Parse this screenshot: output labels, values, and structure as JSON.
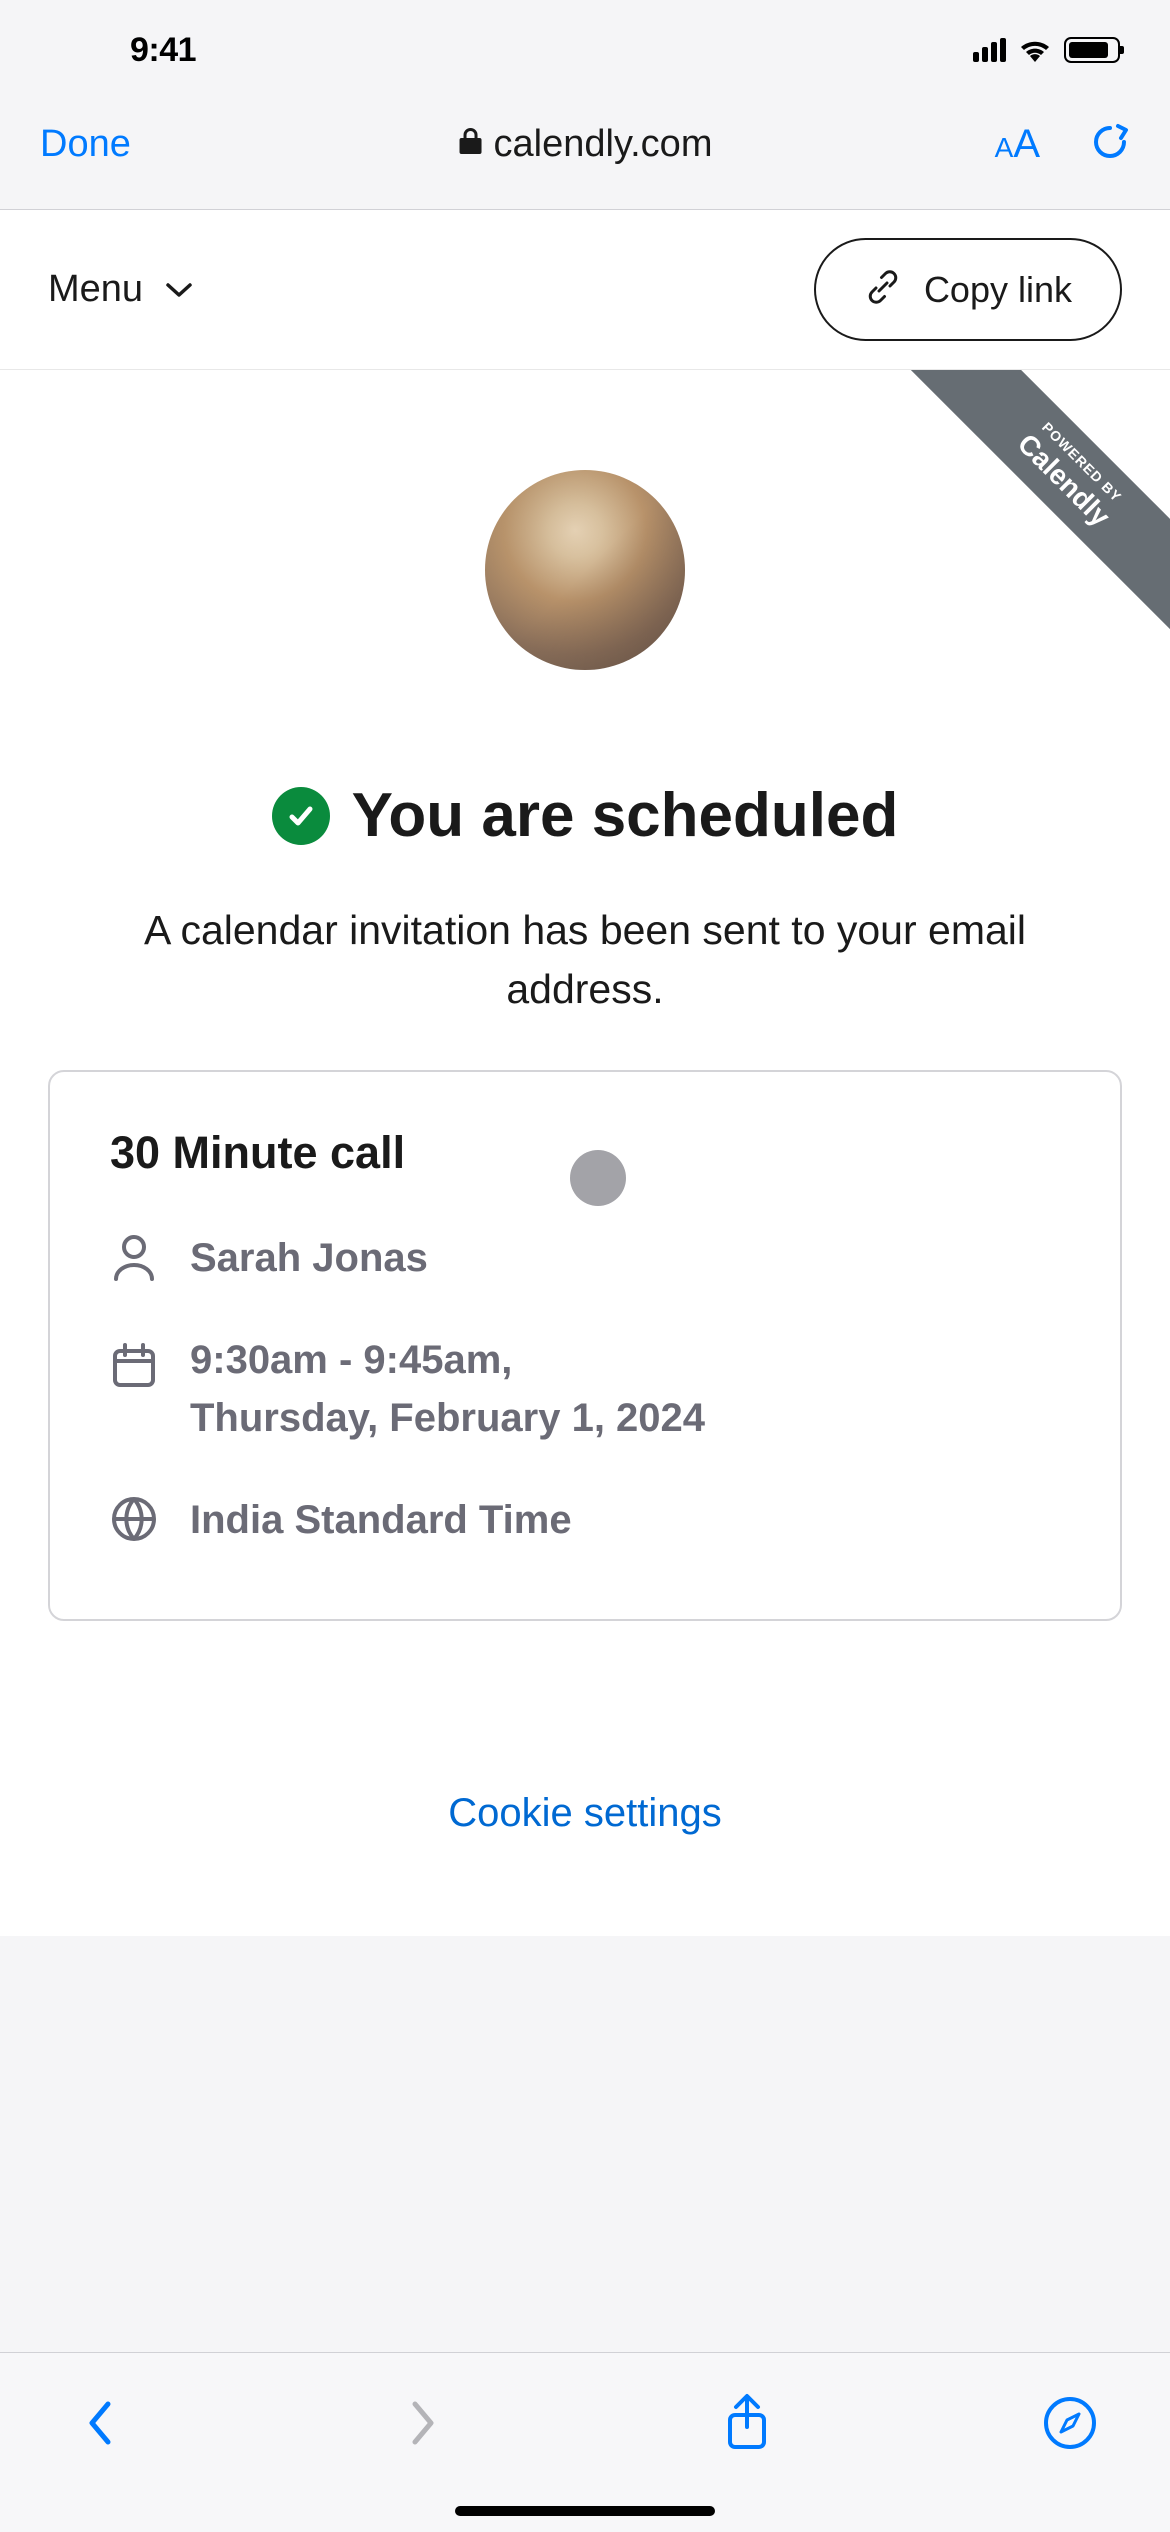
{
  "status_bar": {
    "time": "9:41"
  },
  "browser": {
    "done_label": "Done",
    "url": "calendly.com"
  },
  "header": {
    "menu_label": "Menu",
    "copy_link_label": "Copy link"
  },
  "ribbon": {
    "small": "POWERED BY",
    "big": "Calendly"
  },
  "confirmation": {
    "heading": "You are scheduled",
    "subhead": "A calendar invitation has been sent to your email address."
  },
  "event": {
    "title": "30 Minute call",
    "host": "Sarah Jonas",
    "time_line1": "9:30am - 9:45am,",
    "time_line2": "Thursday, February 1, 2024",
    "timezone": "India Standard Time"
  },
  "cookie_link": "Cookie settings",
  "colors": {
    "ios_blue": "#007aff",
    "link_blue": "#0069d2",
    "success_green": "#0a8b3d",
    "muted_gray": "#6b6b76"
  }
}
